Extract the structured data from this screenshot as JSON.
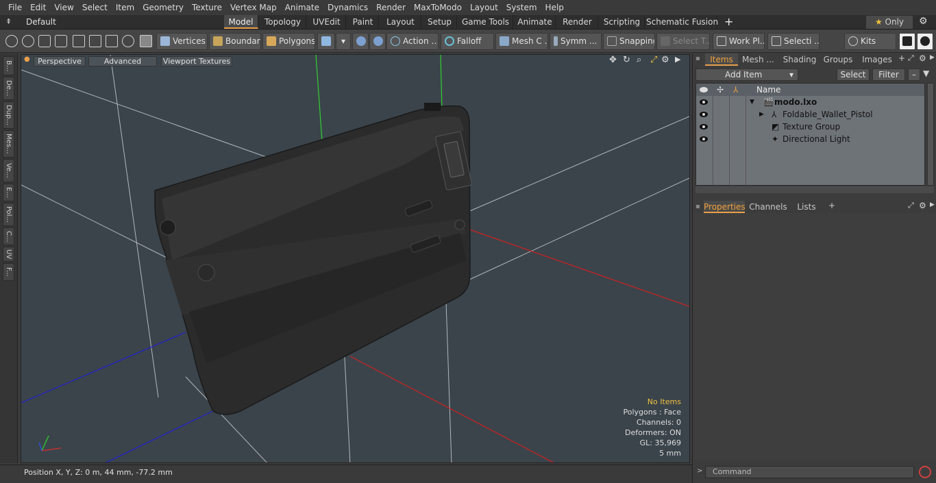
{
  "menu": [
    "File",
    "Edit",
    "View",
    "Select",
    "Item",
    "Geometry",
    "Texture",
    "Vertex Map",
    "Animate",
    "Dynamics",
    "Render",
    "MaxToModo",
    "Layout",
    "System",
    "Help"
  ],
  "layout_selector": "Default Layouts",
  "layout_tabs": [
    "Model",
    "Topology",
    "UVEdit",
    "Paint",
    "Layout",
    "Setup",
    "Game Tools",
    "Animate",
    "Render",
    "Scripting",
    "Schematic Fusion"
  ],
  "active_layout_tab": "Model",
  "only_label": "Only",
  "toolbar": {
    "vertices": "Vertices",
    "boundary": "Boundary",
    "polygons": "Polygons",
    "action": "Action",
    "falloff": "Falloff",
    "mesh": "Mesh C ...",
    "symmetry": "Symm ...",
    "snapping": "Snapping",
    "select_t": "Select T...",
    "work_plane": "Work Pl...",
    "selection": "Selecti ...",
    "kits": "Kits"
  },
  "left_tabs": [
    "B...",
    "De...",
    "Dup...",
    "Mes...",
    "Ve...",
    "E...",
    "Pol...",
    "C...",
    "UV",
    "F..."
  ],
  "viewport": {
    "perspective": "Perspective",
    "advanced": "Advanced",
    "textures": "Viewport Textures",
    "info": {
      "no_items": "No Items",
      "polygons": "Polygons : Face",
      "channels": "Channels: 0",
      "deformers": "Deformers: ON",
      "gl": "GL: 35,969",
      "scale": "5 mm"
    }
  },
  "status": {
    "position": "Position X, Y, Z:   0 m, 44 mm, -77.2 mm"
  },
  "right_tabs_top": [
    "Items",
    "Mesh ...",
    "Shading",
    "Groups",
    "Images"
  ],
  "items_toolbar": {
    "add_item": "Add Item",
    "select": "Select",
    "filter": "Filter"
  },
  "items_header": "Name",
  "items": [
    {
      "name": "modo.lxo",
      "level": 0
    },
    {
      "name": "Foldable_Wallet_Pistol",
      "level": 1
    },
    {
      "name": "Texture Group",
      "level": 1
    },
    {
      "name": "Directional Light",
      "level": 1
    }
  ],
  "right_tabs_bottom": [
    "Properties",
    "Channels",
    "Lists"
  ],
  "command_placeholder": "Command",
  "colors": {
    "accent": "#e8a04a",
    "viewport_bg": "#3b444b",
    "status_warn": "#f0c040"
  }
}
